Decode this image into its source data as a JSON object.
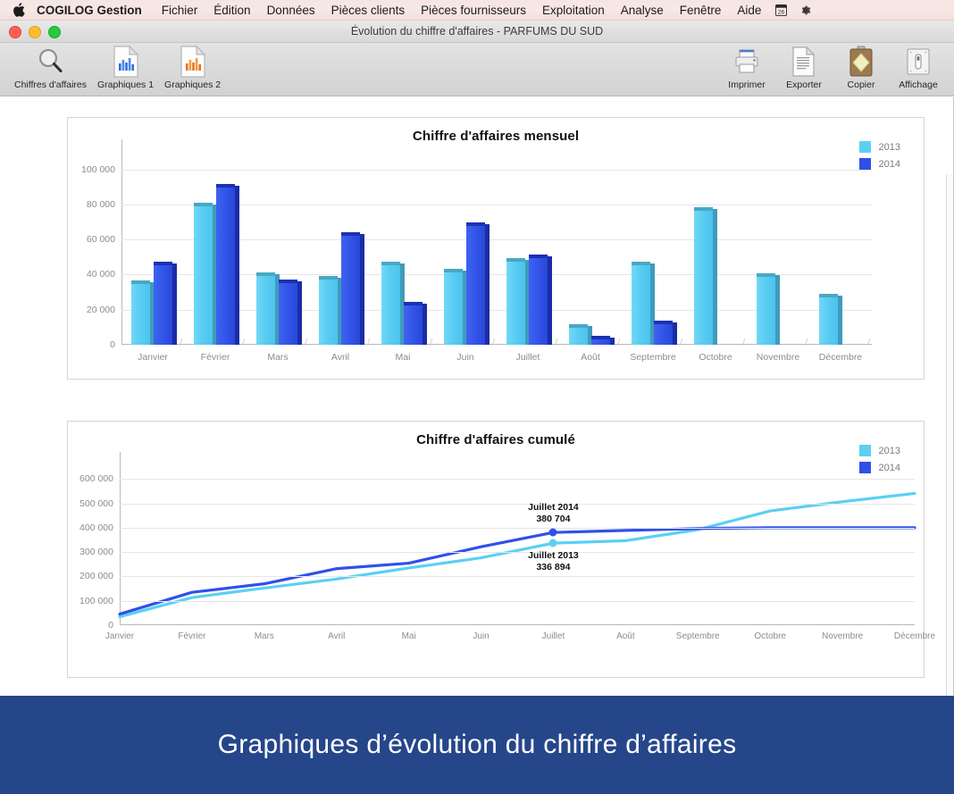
{
  "menubar": {
    "apple_icon": "apple-logo-icon",
    "app_name": "COGILOG Gestion",
    "items": [
      "Fichier",
      "Édition",
      "Données",
      "Pièces clients",
      "Pièces fournisseurs",
      "Exploitation",
      "Analyse",
      "Fenêtre",
      "Aide"
    ],
    "status_icons": [
      "calendar-26-icon",
      "gear-icon"
    ]
  },
  "window": {
    "title": "Évolution du chiffre d'affaires - PARFUMS DU SUD",
    "traffic_lights": [
      "close-button",
      "minimize-button",
      "zoom-button"
    ]
  },
  "toolbar": {
    "left_items": [
      {
        "label": "Chiffres d'affaires",
        "icon": "magnifier-icon"
      },
      {
        "label": "Graphiques 1",
        "icon": "blue-bar-chart-document-icon"
      },
      {
        "label": "Graphiques 2",
        "icon": "orange-bar-chart-document-icon"
      }
    ],
    "right_items": [
      {
        "label": "Imprimer",
        "icon": "printer-icon"
      },
      {
        "label": "Exporter",
        "icon": "document-export-icon"
      },
      {
        "label": "Copier",
        "icon": "clipboard-icon"
      },
      {
        "label": "Affichage",
        "icon": "display-switch-icon"
      }
    ]
  },
  "footer": {
    "caption": "Graphiques d’évolution du chiffre d’affaires"
  },
  "colors": {
    "series_2013": "#5bd0f3",
    "series_2014": "#2f50e8",
    "footer_bg": "#26468a",
    "grid": "#e6e6e6",
    "axis_text": "#8c8c8c"
  },
  "chart_data": [
    {
      "type": "bar",
      "title": "Chiffre d'affaires mensuel",
      "xlabel": "",
      "ylabel": "",
      "ylim": [
        0,
        110000
      ],
      "yticks": [
        0,
        20000,
        40000,
        60000,
        80000,
        100000
      ],
      "ytick_labels": [
        "0",
        "20 000",
        "40 000",
        "60 000",
        "80 000",
        "100 000"
      ],
      "grid": true,
      "legend_position": "top-right",
      "categories": [
        "Janvier",
        "Février",
        "Mars",
        "Avril",
        "Mai",
        "Juin",
        "Juillet",
        "Août",
        "Septembre",
        "Octobre",
        "Novembre",
        "Décembre"
      ],
      "series": [
        {
          "name": "2013",
          "color": "#5bd0f3",
          "values": [
            34500,
            79000,
            39000,
            37000,
            45500,
            41500,
            47500,
            9500,
            45500,
            76500,
            38500,
            27000
          ]
        },
        {
          "name": "2014",
          "color": "#2f50e8",
          "values": [
            45500,
            89500,
            35000,
            62000,
            22500,
            67500,
            49500,
            3000,
            11500,
            null,
            null,
            null
          ]
        }
      ]
    },
    {
      "type": "line",
      "title": "Chiffre d'affaires cumulé",
      "xlabel": "",
      "ylabel": "",
      "ylim": [
        0,
        660000
      ],
      "yticks": [
        0,
        100000,
        200000,
        300000,
        400000,
        500000,
        600000
      ],
      "ytick_labels": [
        "0",
        "100 000",
        "200 000",
        "300 000",
        "400 000",
        "500 000",
        "600 000"
      ],
      "grid": true,
      "legend_position": "top-right",
      "categories": [
        "Janvier",
        "Février",
        "Mars",
        "Avril",
        "Mai",
        "Juin",
        "Juillet",
        "Août",
        "Septembre",
        "Octobre",
        "Novembre",
        "Décembre"
      ],
      "series": [
        {
          "name": "2013",
          "color": "#5bd0f3",
          "values": [
            34500,
            113500,
            152500,
            189500,
            235000,
            276500,
            336894,
            347000,
            392000,
            469000,
            507000,
            541000
          ]
        },
        {
          "name": "2014",
          "color": "#2f50e8",
          "values": [
            45500,
            135000,
            170000,
            232000,
            254500,
            322000,
            380704,
            389000,
            397000,
            400000,
            400000,
            400000
          ]
        }
      ],
      "annotations": [
        {
          "label": "Juillet 2014",
          "value": "380 704",
          "series": "2014",
          "x": "Juillet"
        },
        {
          "label": "Juillet 2013",
          "value": "336 894",
          "series": "2013",
          "x": "Juillet"
        }
      ]
    }
  ]
}
